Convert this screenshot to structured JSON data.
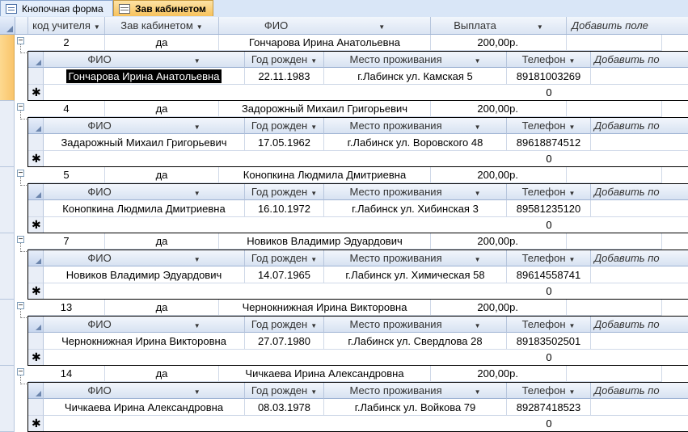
{
  "tabs": [
    {
      "label": "Кнопочная форма",
      "icon": "form-icon",
      "active": false
    },
    {
      "label": "Зав кабинетом",
      "icon": "table-icon",
      "active": true
    }
  ],
  "main_headers": [
    "код учителя",
    "Зав кабинетом",
    "ФИО",
    "Выплата",
    "Добавить поле"
  ],
  "sub_headers": [
    "ФИО",
    "Год рожден",
    "Место проживания",
    "Телефон",
    "Добавить по"
  ],
  "new_row_marker": "✱",
  "new_row_default": "0",
  "records": [
    {
      "code": "2",
      "zav": "да",
      "fio": "Гончарова Ирина Анатольевна",
      "pay": "200,00р.",
      "sub": {
        "fio": "Гончарова Ирина Анатольевна",
        "year": "22.11.1983",
        "place": "г.Лабинск ул. Камская 5",
        "phone": "89181003269"
      }
    },
    {
      "code": "4",
      "zav": "да",
      "fio": "Задорожный Михаил Григорьевич",
      "pay": "200,00р.",
      "sub": {
        "fio": "Задарожный Михаил Григорьевич",
        "year": "17.05.1962",
        "place": "г.Лабинск ул. Воровского 48",
        "phone": "89618874512"
      }
    },
    {
      "code": "5",
      "zav": "да",
      "fio": "Конопкина Людмила Дмитриевна",
      "pay": "200,00р.",
      "sub": {
        "fio": "Конопкина Людмила Дмитриевна",
        "year": "16.10.1972",
        "place": "г.Лабинск ул. Хибинская 3",
        "phone": "89581235120"
      }
    },
    {
      "code": "7",
      "zav": "да",
      "fio": "Новиков Владимир Эдуардович",
      "pay": "200,00р.",
      "sub": {
        "fio": "Новиков Владимир Эдуардович",
        "year": "14.07.1965",
        "place": "г.Лабинск ул. Химическая 58",
        "phone": "89614558741"
      }
    },
    {
      "code": "13",
      "zav": "да",
      "fio": "Чернокнижная Ирина Викторовна",
      "pay": "200,00р.",
      "sub": {
        "fio": "Чернокнижная Ирина Викторовна",
        "year": "27.07.1980",
        "place": "г.Лабинск ул. Свердлова 28",
        "phone": "89183502501"
      }
    },
    {
      "code": "14",
      "zav": "да",
      "fio": "Чичкаева Ирина Александровна",
      "pay": "200,00р.",
      "sub": {
        "fio": "Чичкаева Ирина Александровна",
        "year": "08.03.1978",
        "place": "г.Лабинск ул. Войкова 79",
        "phone": "89287418523"
      }
    }
  ],
  "colors": {
    "active_tab": "#f7c25c",
    "selected_record": "#f9c46b",
    "header_bg": "#dbe5f3"
  }
}
